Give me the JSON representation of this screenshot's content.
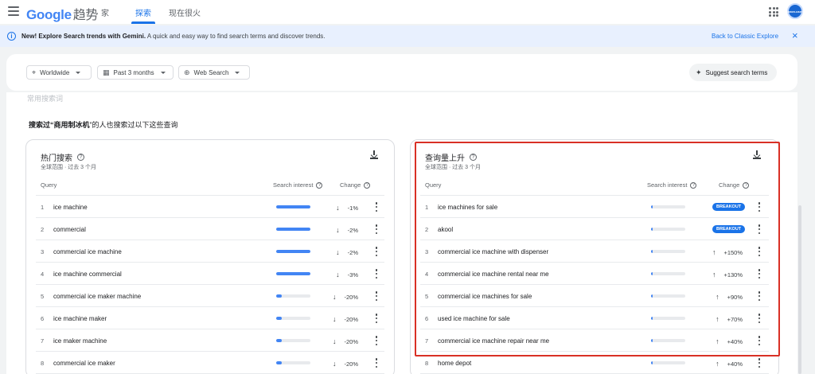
{
  "app": {
    "logo_google": "Google",
    "logo_trends": "趋势",
    "tabs": [
      {
        "label": "家"
      },
      {
        "label": "探索"
      },
      {
        "label": "现在很火"
      }
    ],
    "avatar_text": "anon.user"
  },
  "banner": {
    "bold": "New! Explore Search trends with Gemini.",
    "text": " A quick and easy way to find search terms and discover trends.",
    "link": "Back to Classic Explore",
    "close_icon": "×",
    "info_icon": "i"
  },
  "filters": {
    "location": "Worldwide",
    "time": "Past 3 months",
    "property": "Web Search",
    "suggest": "Suggest search terms"
  },
  "section": {
    "ghost_label": "常用搜索词",
    "title_prefix": "搜索过“",
    "title_term": "商用制冰机",
    "title_suffix": "”的人也搜索过以下这些查询"
  },
  "colors": {
    "accent": "#1a73e8",
    "bar": "#4285f4",
    "highlight": "#d93025"
  },
  "top_panel": {
    "title": "热门搜索",
    "subtitle": "全球范围 · 过去 3 个月",
    "col_query": "Query",
    "col_interest": "Search interest",
    "col_change": "Change",
    "rows": [
      {
        "idx": "1",
        "query": "ice machine",
        "interest": 1.0,
        "arrow": "↓",
        "change": "-1%"
      },
      {
        "idx": "2",
        "query": "commercial",
        "interest": 1.0,
        "arrow": "↓",
        "change": "-2%"
      },
      {
        "idx": "3",
        "query": "commercial ice machine",
        "interest": 1.0,
        "arrow": "↓",
        "change": "-2%"
      },
      {
        "idx": "4",
        "query": "ice machine commercial",
        "interest": 1.0,
        "arrow": "↓",
        "change": "-3%"
      },
      {
        "idx": "5",
        "query": "commercial ice maker machine",
        "interest": 0.16,
        "arrow": "↓",
        "change": "-20%"
      },
      {
        "idx": "6",
        "query": "ice machine maker",
        "interest": 0.16,
        "arrow": "↓",
        "change": "-20%"
      },
      {
        "idx": "7",
        "query": "ice maker machine",
        "interest": 0.16,
        "arrow": "↓",
        "change": "-20%"
      },
      {
        "idx": "8",
        "query": "commercial ice maker",
        "interest": 0.16,
        "arrow": "↓",
        "change": "-20%"
      }
    ]
  },
  "rising_panel": {
    "title": "查询量上升",
    "subtitle": "全球范围 · 过去 3 个月",
    "col_query": "Query",
    "col_interest": "Search interest",
    "col_change": "Change",
    "breakout_label": "BREAKOUT",
    "rows": [
      {
        "idx": "1",
        "query": "ice machines for sale",
        "interest": 0.04,
        "arrow": "",
        "change": "BREAKOUT"
      },
      {
        "idx": "2",
        "query": "akool",
        "interest": 0.04,
        "arrow": "",
        "change": "BREAKOUT"
      },
      {
        "idx": "3",
        "query": "commercial ice machine with dispenser",
        "interest": 0.04,
        "arrow": "↑",
        "change": "+150%"
      },
      {
        "idx": "4",
        "query": "commercial ice machine rental near me",
        "interest": 0.04,
        "arrow": "↑",
        "change": "+130%"
      },
      {
        "idx": "5",
        "query": "commercial ice machines for sale",
        "interest": 0.04,
        "arrow": "↑",
        "change": "+90%"
      },
      {
        "idx": "6",
        "query": "used ice machine for sale",
        "interest": 0.04,
        "arrow": "↑",
        "change": "+70%"
      },
      {
        "idx": "7",
        "query": "commercial ice machine repair near me",
        "interest": 0.04,
        "arrow": "↑",
        "change": "+40%"
      },
      {
        "idx": "8",
        "query": "home depot",
        "interest": 0.04,
        "arrow": "↑",
        "change": "+40%"
      }
    ]
  }
}
